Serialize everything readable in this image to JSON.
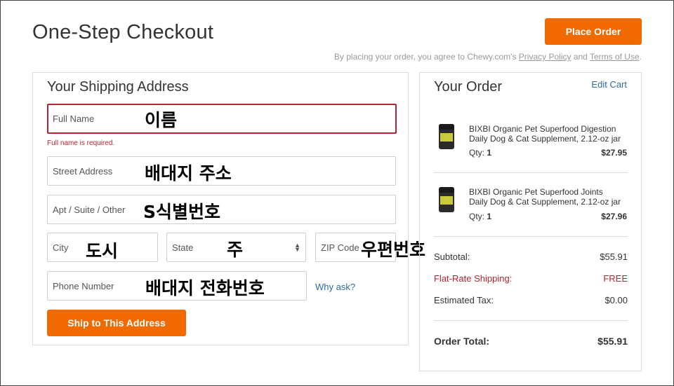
{
  "page": {
    "title": "One-Step Checkout",
    "place_order_label": "Place Order",
    "agreement": {
      "prefix": "By placing your order, you agree to Chewy.com's ",
      "privacy_label": "Privacy Policy",
      "and": " and ",
      "terms_label": "Terms of Use",
      "suffix": "."
    }
  },
  "shipping": {
    "title": "Your Shipping Address",
    "full_name": {
      "placeholder": "Full Name",
      "overlay": "이름",
      "error": "Full name is required."
    },
    "street": {
      "placeholder": "Street Address",
      "overlay": "배대지 주소"
    },
    "apt": {
      "placeholder": "Apt / Suite / Other",
      "overlay": "S식별번호"
    },
    "city": {
      "placeholder": "City",
      "overlay": "도시"
    },
    "state": {
      "placeholder": "State",
      "overlay": "주"
    },
    "zip": {
      "placeholder": "ZIP Code",
      "overlay": "우편번호"
    },
    "phone": {
      "placeholder": "Phone Number",
      "overlay": "배대지 전화번호"
    },
    "why_ask": "Why ask?",
    "ship_button": "Ship to This Address"
  },
  "order": {
    "title": "Your Order",
    "edit_cart": "Edit Cart",
    "items": [
      {
        "name": "BIXBI Organic Pet Superfood Digestion Daily Dog & Cat Supplement, 2.12-oz jar",
        "qty_label": "Qty:",
        "qty": "1",
        "price": "$27.95"
      },
      {
        "name": "BIXBI Organic Pet Superfood Joints Daily Dog & Cat Supplement, 2.12-oz jar",
        "qty_label": "Qty:",
        "qty": "1",
        "price": "$27.96"
      }
    ],
    "summary": {
      "subtotal_label": "Subtotal:",
      "subtotal": "$55.91",
      "shipping_label": "Flat-Rate Shipping:",
      "shipping": "FREE",
      "tax_label": "Estimated Tax:",
      "tax": "$0.00",
      "total_label": "Order Total:",
      "total": "$55.91"
    }
  },
  "colors": {
    "accent": "#f16a00",
    "error": "#b4262d",
    "link": "#2e6aa0"
  }
}
